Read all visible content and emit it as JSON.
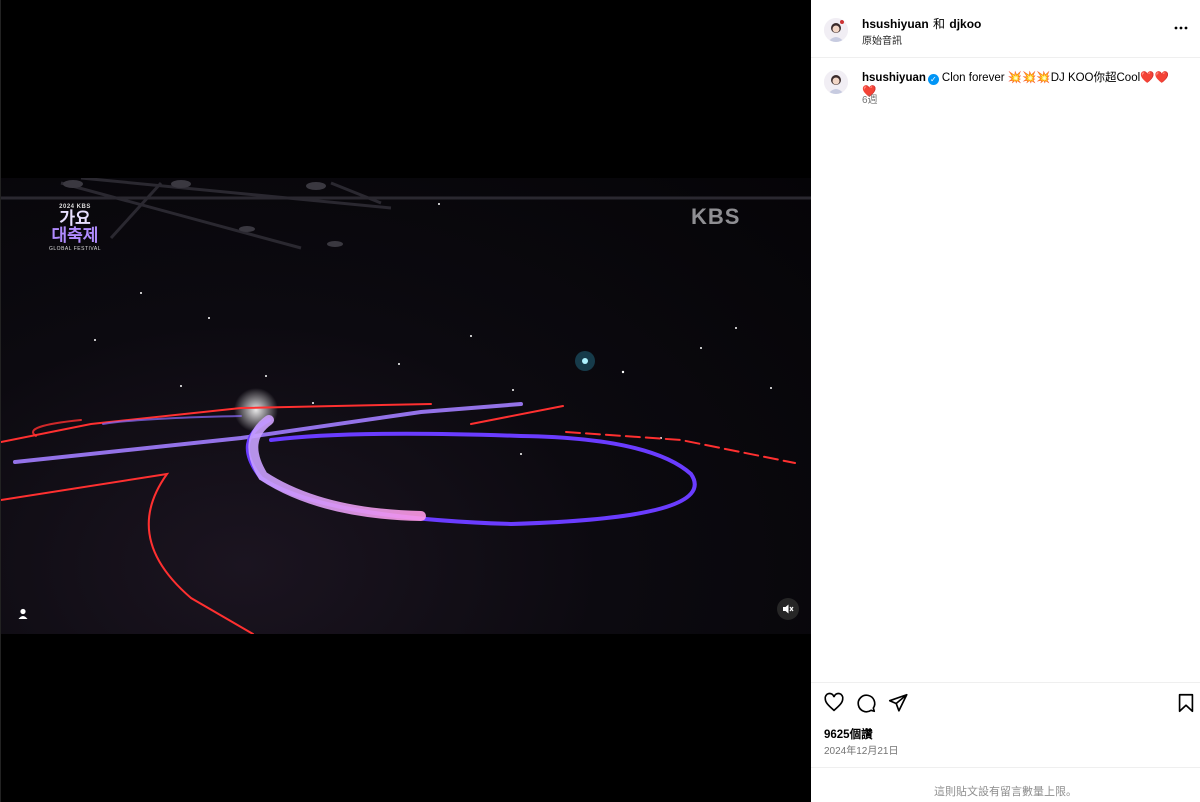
{
  "video": {
    "watermark": "KBS",
    "festival_logo": {
      "year": "2024 KBS",
      "line1": "가요",
      "line2": "대축제",
      "subtitle": "GLOBAL FESTIVAL"
    }
  },
  "header": {
    "user1": "hsushiyuan",
    "joiner": "和",
    "user2": "djkoo",
    "audio_label": "原始音訊"
  },
  "comment": {
    "username": "hsushiyuan",
    "text": "Clon forever 💥💥💥DJ KOO你超Cool❤️❤️❤️",
    "age": "6週"
  },
  "engagement": {
    "views": "9625個讚",
    "date": "2024年12月21日",
    "limit_note": "這則貼文設有留言數量上限。"
  },
  "icons": [
    "tag-user-icon",
    "mute-icon",
    "more-options-icon",
    "heart-icon",
    "comment-icon",
    "share-icon",
    "bookmark-icon",
    "verified-icon"
  ]
}
